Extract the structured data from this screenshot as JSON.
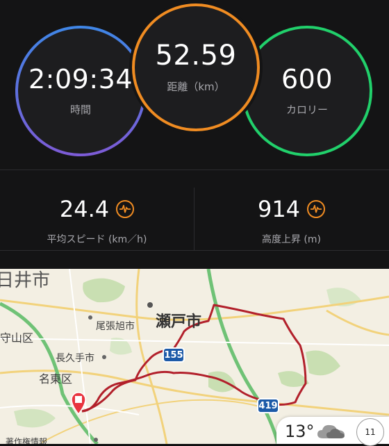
{
  "rings": {
    "time": {
      "value": "2:09:34",
      "label": "時間",
      "color": "#3f86e6"
    },
    "distance": {
      "value": "52.59",
      "label": "距離（km）",
      "color": "#f08c22"
    },
    "calories": {
      "value": "600",
      "label": "カロリー",
      "color": "#21d06b"
    }
  },
  "metrics": {
    "avg_speed": {
      "value": "24.4",
      "label": "平均スピード (km／h)",
      "icon": "pulse-chart-icon"
    },
    "elevation_gain": {
      "value": "914",
      "label": "高度上昇 (m)",
      "icon": "pulse-chart-icon"
    }
  },
  "map": {
    "labels": {
      "city_top": "日井市",
      "seto": "瀬戸市",
      "owariasahi": "尾張旭市",
      "moriyama": "守山区",
      "nagakute": "長久手市",
      "meito": "名東区",
      "bottom": "著作権情報"
    },
    "route_shields": {
      "r155": "155",
      "r419": "419"
    },
    "route_color": "#b2202b"
  },
  "weather": {
    "temperature": "13°",
    "icon": "cloud-icon"
  },
  "compass": {
    "value": "11"
  }
}
